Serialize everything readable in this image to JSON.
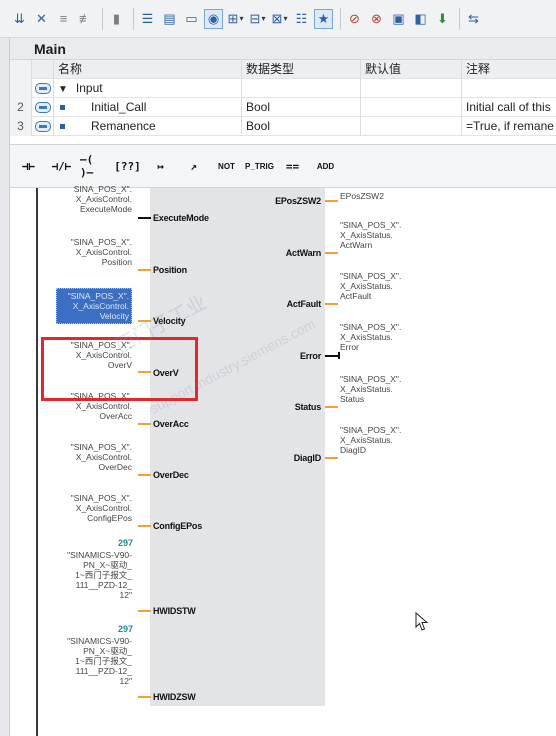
{
  "toolbar": {
    "buttons": [
      "insert-network-icon",
      "delete-network-icon",
      "insert-row-icon",
      "delete-row-icon",
      "open-all-icon",
      "close-all-icon",
      "show-favorites-icon",
      "comment-icon",
      "abs-symbolic-icon",
      "go-to-icon",
      "monitor-icon",
      "breakpoint-icon",
      "monitor-all-icon",
      "download-icon",
      "compare-icon"
    ]
  },
  "interface": {
    "title": "Main",
    "columns": [
      "名称",
      "数据类型",
      "默认值",
      "注释"
    ],
    "rows": [
      {
        "num": "",
        "name": "Input",
        "type": "",
        "default": "",
        "comment": ""
      },
      {
        "num": "2",
        "name": "Initial_Call",
        "type": "Bool",
        "default": "",
        "comment": "Initial call of this"
      },
      {
        "num": "3",
        "name": "Remanence",
        "type": "Bool",
        "default": "",
        "comment": "=True, if remane"
      }
    ]
  },
  "ladbar": {
    "items": [
      "⊣⊢",
      "⊣/⊢",
      "–( )–",
      "[??]",
      "↦",
      "↗",
      "NOT",
      "P_TRIG",
      "==",
      "ADD"
    ]
  },
  "network": {
    "inputs": [
      {
        "pin": "ExecuteMode",
        "arg": "SINA_POS_X\".\nX_AxisControl.\nExecuteMode"
      },
      {
        "pin": "Position",
        "arg": "\"SINA_POS_X\".\nX_AxisControl.\nPosition"
      },
      {
        "pin": "Velocity",
        "arg": "\"SINA_POS_X\".\nX_AxisControl.\nVelocity"
      },
      {
        "pin": "OverV",
        "arg": "\"SINA_POS_X\".\nX_AxisControl.\nOverV"
      },
      {
        "pin": "OverAcc",
        "arg": "\"SINA_POS_X\".\nX_AxisControl.\nOverAcc"
      },
      {
        "pin": "OverDec",
        "arg": "\"SINA_POS_X\".\nX_AxisControl.\nOverDec"
      },
      {
        "pin": "ConfigEPos",
        "arg": "\"SINA_POS_X\".\nX_AxisControl.\nConfigEPos"
      },
      {
        "pin": "HWIDSTW",
        "const": "297",
        "arg": "\"SINAMICS-V90-\nPN_X~驱动_\n1~西门子报文_\n111__PZD-12_\n12\""
      },
      {
        "pin": "HWIDZSW",
        "const": "297",
        "arg": "\"SINAMICS-V90-\nPN_X~驱动_\n1~西门子报文_\n111__PZD-12_\n12\""
      }
    ],
    "outputs": [
      {
        "pin": "EPosZSW2",
        "arg": "EPosZSW2"
      },
      {
        "pin": "ActWarn",
        "arg": "\"SINA_POS_X\".\nX_AxisStatus.\nActWarn"
      },
      {
        "pin": "ActFault",
        "arg": "\"SINA_POS_X\".\nX_AxisStatus.\nActFault"
      },
      {
        "pin": "Error",
        "arg": "\"SINA_POS_X\".\nX_AxisStatus.\nError"
      },
      {
        "pin": "Status",
        "arg": "\"SINA_POS_X\".\nX_AxisStatus.\nStatus"
      },
      {
        "pin": "DiagID",
        "arg": "\"SINA_POS_X\".\nX_AxisStatus.\nDiagID"
      }
    ],
    "selected_input": "Velocity",
    "highlighted_input": "OverV"
  },
  "watermark": {
    "line1": "西门子工业",
    "line2": "support.industry.siemens.com"
  },
  "colors": {
    "wire_input": "#f2a13a",
    "highlight_box": "#e2262b",
    "selection": "#3a6fc4",
    "constant": "#208a8e"
  }
}
